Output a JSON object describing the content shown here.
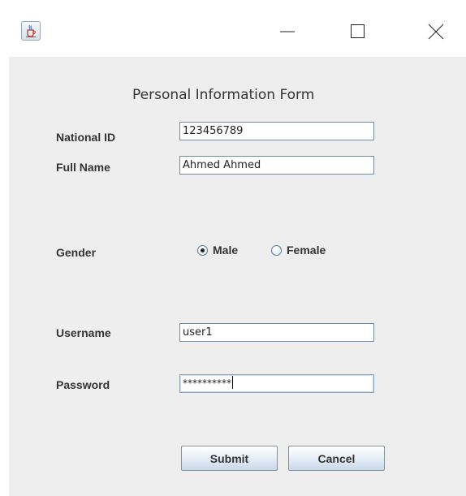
{
  "form": {
    "title": "Personal Information Form",
    "national_id": {
      "label": "National ID",
      "value": "123456789"
    },
    "full_name": {
      "label": "Full Name",
      "value": "Ahmed Ahmed"
    },
    "gender": {
      "label": "Gender",
      "options": [
        {
          "label": "Male",
          "selected": true
        },
        {
          "label": "Female",
          "selected": false
        }
      ]
    },
    "username": {
      "label": "Username",
      "value": "user1"
    },
    "password": {
      "label": "Password",
      "masked_value": "**********"
    },
    "buttons": {
      "submit": "Submit",
      "cancel": "Cancel"
    }
  },
  "icons": {
    "app": "java-cup-icon",
    "minimize": "minimize-icon",
    "maximize": "maximize-icon",
    "close": "close-icon"
  },
  "colors": {
    "panel_background": "#eeeeee",
    "button_border": "#7a93b3",
    "field_border": "#7a8a99"
  }
}
